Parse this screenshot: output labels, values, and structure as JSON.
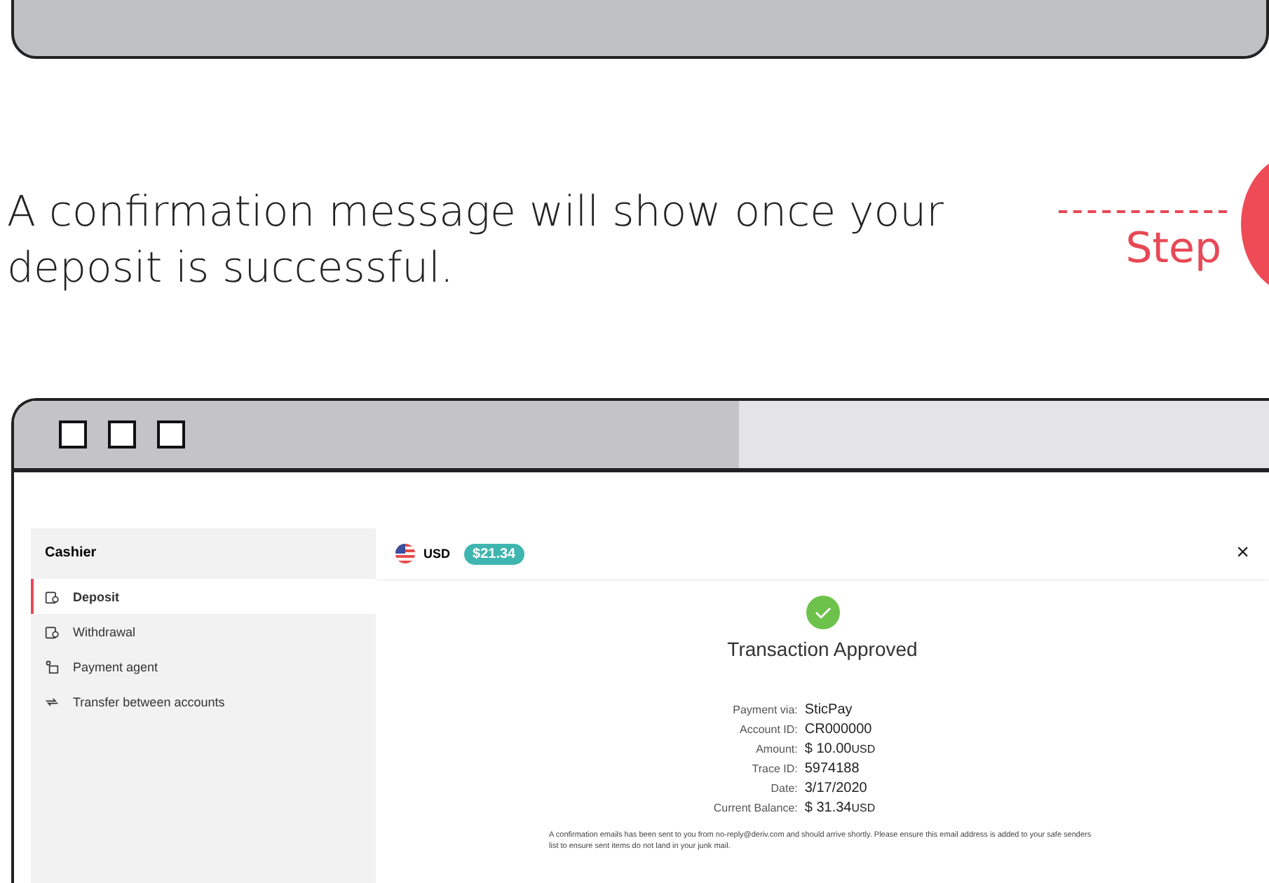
{
  "intro": {
    "text": "A confirmation message will show once your deposit is successful.",
    "step_label": "Step"
  },
  "sidebar": {
    "title": "Cashier",
    "items": [
      {
        "label": "Deposit",
        "kind": "deposit",
        "selected": true
      },
      {
        "label": "Withdrawal",
        "kind": "withdrawal",
        "selected": false
      },
      {
        "label": "Payment agent",
        "kind": "agent",
        "selected": false
      },
      {
        "label": "Transfer between accounts",
        "kind": "transfer",
        "selected": false
      }
    ]
  },
  "header": {
    "currency": "USD",
    "balance": "$21.34",
    "close": "×"
  },
  "result": {
    "title": "Transaction Approved",
    "details": [
      {
        "label": "Payment via:",
        "value": "SticPay"
      },
      {
        "label": "Account ID:",
        "value": "CR000000"
      },
      {
        "label": "Amount:",
        "value": "$ 10.00",
        "unit": "USD"
      },
      {
        "label": "Trace ID:",
        "value": "5974188"
      },
      {
        "label": "Date:",
        "value": "3/17/2020"
      },
      {
        "label": "Current Balance:",
        "value": "$ 31.34",
        "unit": "USD"
      }
    ],
    "note": "A confirmation emails has been sent to you from no-reply@deriv.com and should arrive shortly. Please ensure this email address is added to your safe senders list to ensure sent items do not land in your junk mail."
  }
}
